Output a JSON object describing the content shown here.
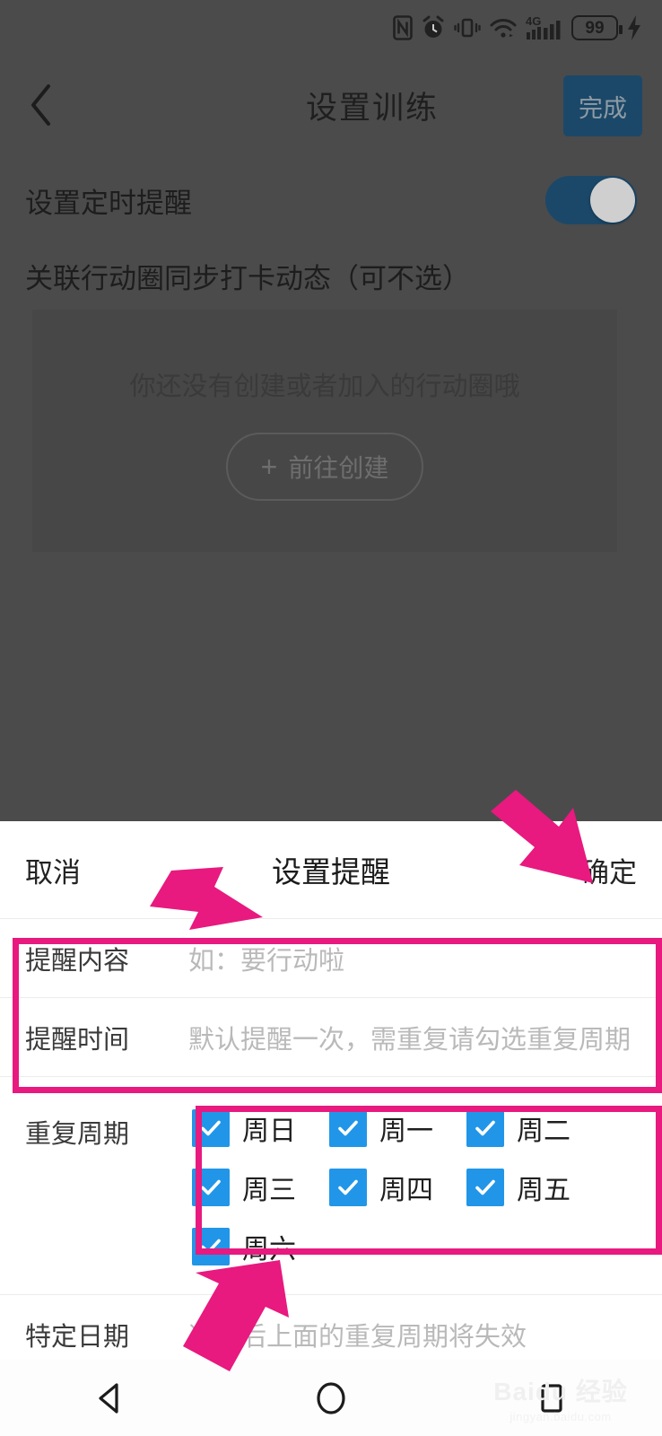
{
  "status_bar": {
    "icons": [
      "nfc-icon",
      "alarm-icon",
      "vibrate-icon",
      "wifi-icon",
      "signal-4g-icon",
      "battery-icon",
      "charging-bolt-icon"
    ],
    "network_label": "4G",
    "battery_level": "99"
  },
  "app": {
    "back_icon": "back-chevron-icon",
    "title": "设置训练",
    "done_label": "完成",
    "rows": {
      "reminder_label": "设置定时提醒",
      "reminder_toggle_state": "on",
      "circle_label": "关联行动圈同步打卡动态（可不选）"
    },
    "circle_card": {
      "empty_text": "你还没有创建或者加入的行动圈哦",
      "create_button_label": "前往创建",
      "create_button_icon": "plus-icon"
    }
  },
  "sheet": {
    "cancel_label": "取消",
    "title": "设置提醒",
    "confirm_label": "确定",
    "fields": [
      {
        "label": "提醒内容",
        "value": "如：要行动啦"
      },
      {
        "label": "提醒时间",
        "value": "默认提醒一次，需重复请勾选重复周期"
      }
    ],
    "repeat": {
      "label": "重复周期",
      "days": [
        {
          "label": "周日",
          "checked": true
        },
        {
          "label": "周一",
          "checked": true
        },
        {
          "label": "周二",
          "checked": true
        },
        {
          "label": "周三",
          "checked": true
        },
        {
          "label": "周四",
          "checked": true
        },
        {
          "label": "周五",
          "checked": true
        },
        {
          "label": "周六",
          "checked": true
        }
      ]
    },
    "specific_date": {
      "label": "特定日期",
      "value": "选择后上面的重复周期将失效"
    }
  },
  "nav_bar": {
    "back_icon": "nav-back-triangle-icon",
    "home_icon": "nav-home-circle-icon",
    "recents_icon": "nav-recents-square-icon"
  },
  "watermark": {
    "main": "Baidu 经验",
    "sub": "jingyan.baidu.com"
  },
  "annotations": {
    "highlight_color": "#e8197f",
    "boxes": [
      "reminder-fields-box",
      "weekday-checkbox-box"
    ],
    "arrows": [
      "arrow-to-confirm",
      "arrow-to-sheet-title",
      "arrow-to-weekday-box"
    ]
  },
  "colors": {
    "accent_blue": "#2196e8",
    "toggle_blue": "#1b4869",
    "done_button": "#1b4869",
    "annotation_pink": "#e8197f",
    "overlay_gray": "#4b4b4b"
  }
}
